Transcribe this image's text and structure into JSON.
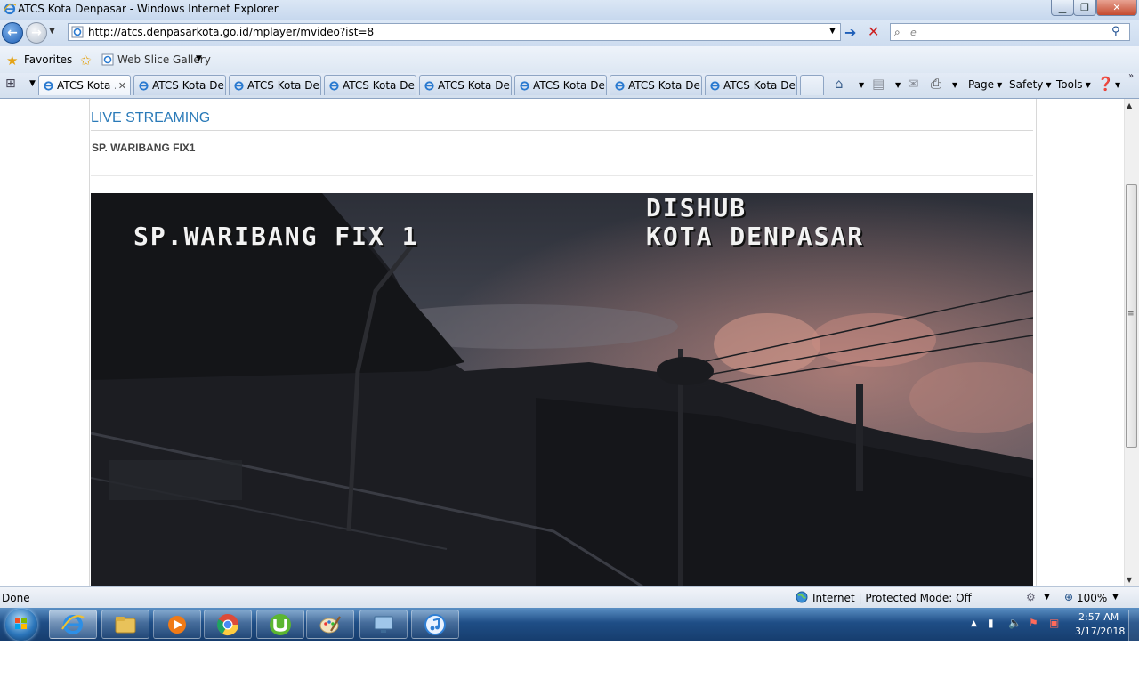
{
  "window": {
    "title": "ATCS Kota Denpasar - Windows Internet Explorer"
  },
  "address_bar": {
    "url": "http://atcs.denpasarkota.go.id/mplayer/mvideo?ist=8"
  },
  "search": {
    "placeholder": "e"
  },
  "favorites_bar": {
    "favorites_label": "Favorites",
    "web_slice_label": "Web Slice Gallery"
  },
  "tabs": [
    {
      "label": "ATCS Kota ...",
      "active": true
    },
    {
      "label": "ATCS Kota De..."
    },
    {
      "label": "ATCS Kota De..."
    },
    {
      "label": "ATCS Kota De..."
    },
    {
      "label": "ATCS Kota De..."
    },
    {
      "label": "ATCS Kota De..."
    },
    {
      "label": "ATCS Kota De..."
    },
    {
      "label": "ATCS Kota De..."
    }
  ],
  "command_bar": {
    "page": "Page",
    "safety": "Safety",
    "tools": "Tools"
  },
  "page": {
    "heading": "LIVE STREAMING",
    "camera_name": "SP. WARIBANG FIX1",
    "video_overlay": {
      "camera": "SP.WARIBANG FIX 1",
      "org_line1": "DISHUB",
      "org_line2": "KOTA DENPASAR"
    }
  },
  "status_bar": {
    "status": "Done",
    "zone": "Internet | Protected Mode: Off",
    "zoom": "100%"
  },
  "taskbar": {
    "time": "2:57 AM",
    "date": "3/17/2018",
    "apps": [
      "internet-explorer",
      "file-explorer",
      "media-player",
      "chrome",
      "utorrent",
      "paint",
      "remote-desktop",
      "itunes"
    ]
  },
  "colors": {
    "heading": "#2a7ab8",
    "taskbar": "#1f4e86",
    "ie_blue": "#1e6fc4"
  }
}
